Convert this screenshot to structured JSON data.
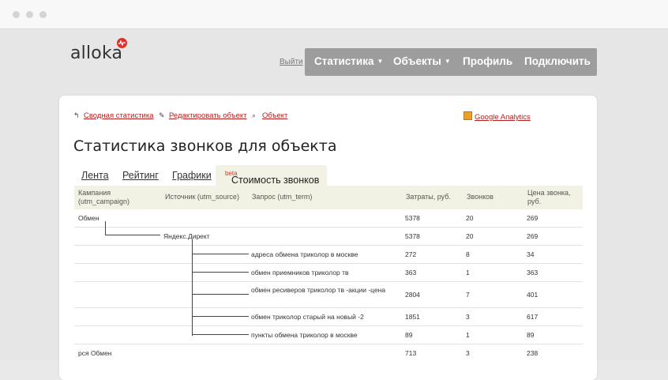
{
  "header": {
    "logo": "alloka",
    "logout": "Выйти",
    "nav": [
      "Статистика",
      "Объекты",
      "Профиль",
      "Подключить"
    ]
  },
  "links": {
    "summary": "Сводная статистика",
    "edit": "Редактировать объект",
    "object": "Объект",
    "ga": "Google Analytics"
  },
  "page_title": "Статистика звонков для объекта",
  "tabs": {
    "feed": "Лента",
    "rating": "Рейтинг",
    "charts": "Графики",
    "cost": "Стоимость звонков",
    "beta": "beta"
  },
  "table": {
    "headers": [
      "Кампания (utm_campaign)",
      "Источник (utm_source)",
      "Запрос (utm_term)",
      "Затраты, руб.",
      "Звонков",
      "Цена звонка, руб."
    ],
    "rows": [
      {
        "campaign": "Обмен",
        "source": "",
        "term": "",
        "cost": "5378",
        "calls": "20",
        "price": "269"
      },
      {
        "campaign": "",
        "source": "Яндекс.Директ",
        "term": "",
        "cost": "5378",
        "calls": "20",
        "price": "269"
      },
      {
        "campaign": "",
        "source": "",
        "term": "адреса обмена триколор в москве",
        "cost": "272",
        "calls": "8",
        "price": "34"
      },
      {
        "campaign": "",
        "source": "",
        "term": "обмен приемников триколор тв",
        "cost": "363",
        "calls": "1",
        "price": "363"
      },
      {
        "campaign": "",
        "source": "",
        "term": "обмен ресиверов триколор тв -акции -цена",
        "cost": "2804",
        "calls": "7",
        "price": "401"
      },
      {
        "campaign": "",
        "source": "",
        "term": "обмен триколор старый на новый -2",
        "cost": "1851",
        "calls": "3",
        "price": "617"
      },
      {
        "campaign": "",
        "source": "",
        "term": "пункты обмена триколор в москве",
        "cost": "89",
        "calls": "1",
        "price": "89"
      },
      {
        "campaign": "рся Обмен",
        "source": "",
        "term": "",
        "cost": "713",
        "calls": "3",
        "price": "238"
      }
    ]
  }
}
